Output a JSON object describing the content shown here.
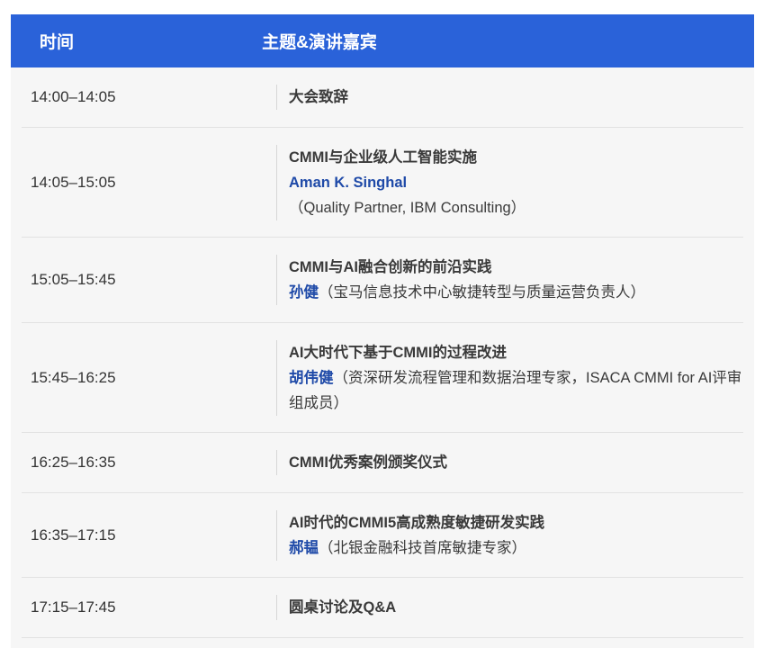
{
  "header": {
    "time_label": "时间",
    "topic_label": "主题&演讲嘉宾"
  },
  "rows": [
    {
      "time": "14:00–14:05",
      "topic": "大会致辞",
      "speaker": "",
      "affil": ""
    },
    {
      "time": "14:05–15:05",
      "topic": "CMMI与企业级人工智能实施",
      "speaker": "Aman K. Singhal",
      "affil": "（Quality Partner, IBM Consulting）"
    },
    {
      "time": "15:05–15:45",
      "topic": "CMMI与AI融合创新的前沿实践",
      "speaker": "孙健",
      "affil": "（宝马信息技术中心敏捷转型与质量运营负责人）"
    },
    {
      "time": "15:45–16:25",
      "topic": "AI大时代下基于CMMI的过程改进",
      "speaker": "胡伟健",
      "affil": "（资深研发流程管理和数据治理专家，ISACA CMMI for AI评审组成员）"
    },
    {
      "time": "16:25–16:35",
      "topic": "CMMI优秀案例颁奖仪式",
      "speaker": "",
      "affil": ""
    },
    {
      "time": "16:35–17:15",
      "topic": "AI时代的CMMI5高成熟度敏捷研发实践",
      "speaker": "郝韫",
      "affil": "（北银金融科技首席敏捷专家）"
    },
    {
      "time": "17:15–17:45",
      "topic": "圆桌讨论及Q&A",
      "speaker": "",
      "affil": ""
    }
  ]
}
